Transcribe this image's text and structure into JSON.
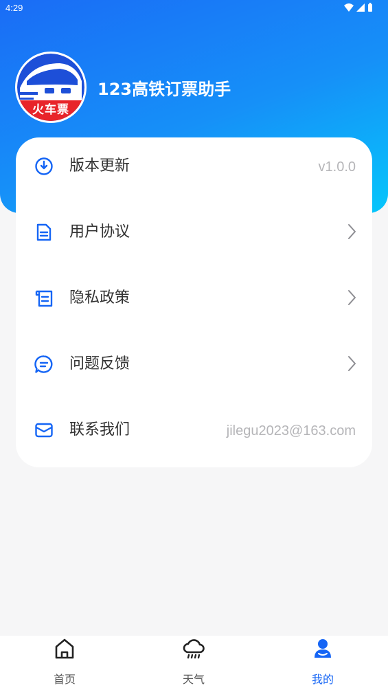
{
  "status_bar": {
    "time": "4:29"
  },
  "header": {
    "app_name": "123高铁订票助手",
    "logo_text": "火车票"
  },
  "menu": {
    "items": [
      {
        "label": "版本更新",
        "value": "v1.0.0",
        "icon": "download-circle-icon"
      },
      {
        "label": "用户协议",
        "icon": "document-icon"
      },
      {
        "label": "隐私政策",
        "icon": "scroll-icon"
      },
      {
        "label": "问题反馈",
        "icon": "chat-bubble-icon"
      },
      {
        "label": "联系我们",
        "value": "jilegu2023@163.com",
        "icon": "mail-icon"
      }
    ]
  },
  "tabbar": {
    "tabs": [
      {
        "label": "首页",
        "icon": "home-icon"
      },
      {
        "label": "天气",
        "icon": "rain-cloud-icon"
      },
      {
        "label": "我的",
        "icon": "user-icon",
        "active": true
      }
    ]
  },
  "colors": {
    "accent": "#1565f5",
    "header_start": "#1a6cf6",
    "header_end": "#06c6fb",
    "logo_red": "#e8242a"
  }
}
